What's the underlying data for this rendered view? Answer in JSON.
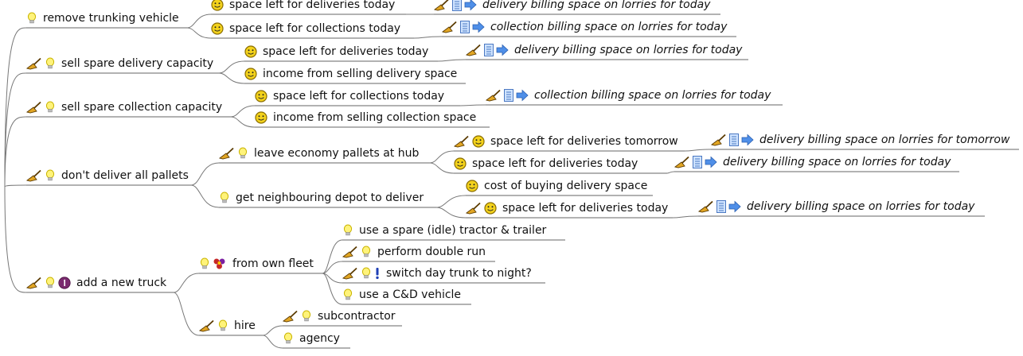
{
  "mindmap": {
    "branches": [
      {
        "label": "remove trunking vehicle",
        "icons": [
          "bulb-icon"
        ],
        "children": [
          {
            "label": "space left for deliveries today",
            "icons": [
              "smiley-icon"
            ],
            "children": [
              {
                "label": "delivery billing space on lorries for today",
                "icons": [
                  "broom-icon",
                  "list-icon",
                  "arrow-right-icon"
                ],
                "italic": true
              }
            ]
          },
          {
            "label": "space left for collections today",
            "icons": [
              "smiley-icon"
            ],
            "children": [
              {
                "label": "collection billing space on lorries for today",
                "icons": [
                  "broom-icon",
                  "list-icon",
                  "arrow-right-icon"
                ],
                "italic": true
              }
            ]
          }
        ]
      },
      {
        "label": "sell spare delivery capacity",
        "icons": [
          "broom-icon",
          "bulb-icon"
        ],
        "children": [
          {
            "label": "space left for deliveries today",
            "icons": [
              "smiley-icon"
            ],
            "children": [
              {
                "label": "delivery billing space on lorries for today",
                "icons": [
                  "broom-icon",
                  "list-icon",
                  "arrow-right-icon"
                ],
                "italic": true
              }
            ]
          },
          {
            "label": "income from selling delivery space",
            "icons": [
              "smiley-icon"
            ]
          }
        ]
      },
      {
        "label": "sell spare collection capacity",
        "icons": [
          "broom-icon",
          "bulb-icon"
        ],
        "children": [
          {
            "label": "space left for collections today",
            "icons": [
              "smiley-icon"
            ],
            "children": [
              {
                "label": "collection billing space on lorries for today",
                "icons": [
                  "broom-icon",
                  "list-icon",
                  "arrow-right-icon"
                ],
                "italic": true
              }
            ]
          },
          {
            "label": "income from selling collection space",
            "icons": [
              "smiley-icon"
            ]
          }
        ]
      },
      {
        "label": "don't deliver all pallets",
        "icons": [
          "broom-icon",
          "bulb-icon"
        ],
        "children": [
          {
            "label": "leave economy pallets at hub",
            "icons": [
              "broom-icon",
              "bulb-icon"
            ],
            "children": [
              {
                "label": "space left for deliveries tomorrow",
                "icons": [
                  "broom-icon",
                  "smiley-icon"
                ],
                "children": [
                  {
                    "label": "delivery billing space on lorries for tomorrow",
                    "icons": [
                      "broom-icon",
                      "list-icon",
                      "arrow-right-icon"
                    ],
                    "italic": true
                  }
                ]
              },
              {
                "label": "space left for deliveries today",
                "icons": [
                  "smiley-icon"
                ],
                "children": [
                  {
                    "label": "delivery billing space on lorries for today",
                    "icons": [
                      "broom-icon",
                      "list-icon",
                      "arrow-right-icon"
                    ],
                    "italic": true
                  }
                ]
              }
            ]
          },
          {
            "label": "get neighbouring depot to deliver",
            "icons": [
              "bulb-icon"
            ],
            "children": [
              {
                "label": "cost of buying delivery space",
                "icons": [
                  "smiley-icon"
                ]
              },
              {
                "label": "space left for deliveries today",
                "icons": [
                  "broom-icon",
                  "smiley-icon"
                ],
                "children": [
                  {
                    "label": "delivery billing space on lorries for today",
                    "icons": [
                      "broom-icon",
                      "list-icon",
                      "arrow-right-icon"
                    ],
                    "italic": true
                  }
                ]
              }
            ]
          }
        ]
      },
      {
        "label": "add a new truck",
        "icons": [
          "broom-icon",
          "bulb-icon",
          "number-one-icon"
        ],
        "children": [
          {
            "label": "from own fleet",
            "icons": [
              "bulb-icon",
              "flower-icon"
            ],
            "children": [
              {
                "label": "use a spare (idle) tractor & trailer",
                "icons": [
                  "bulb-icon"
                ]
              },
              {
                "label": "perform double run",
                "icons": [
                  "broom-icon",
                  "bulb-icon"
                ]
              },
              {
                "label": "switch day trunk to night?",
                "icons": [
                  "broom-icon",
                  "bulb-icon",
                  "exclamation-icon"
                ]
              },
              {
                "label": "use a C&D vehicle",
                "icons": [
                  "bulb-icon"
                ]
              }
            ]
          },
          {
            "label": "hire",
            "icons": [
              "broom-icon",
              "bulb-icon"
            ],
            "children": [
              {
                "label": "subcontractor",
                "icons": [
                  "broom-icon",
                  "bulb-icon"
                ]
              },
              {
                "label": "agency",
                "icons": [
                  "bulb-icon"
                ]
              }
            ]
          }
        ]
      }
    ]
  }
}
